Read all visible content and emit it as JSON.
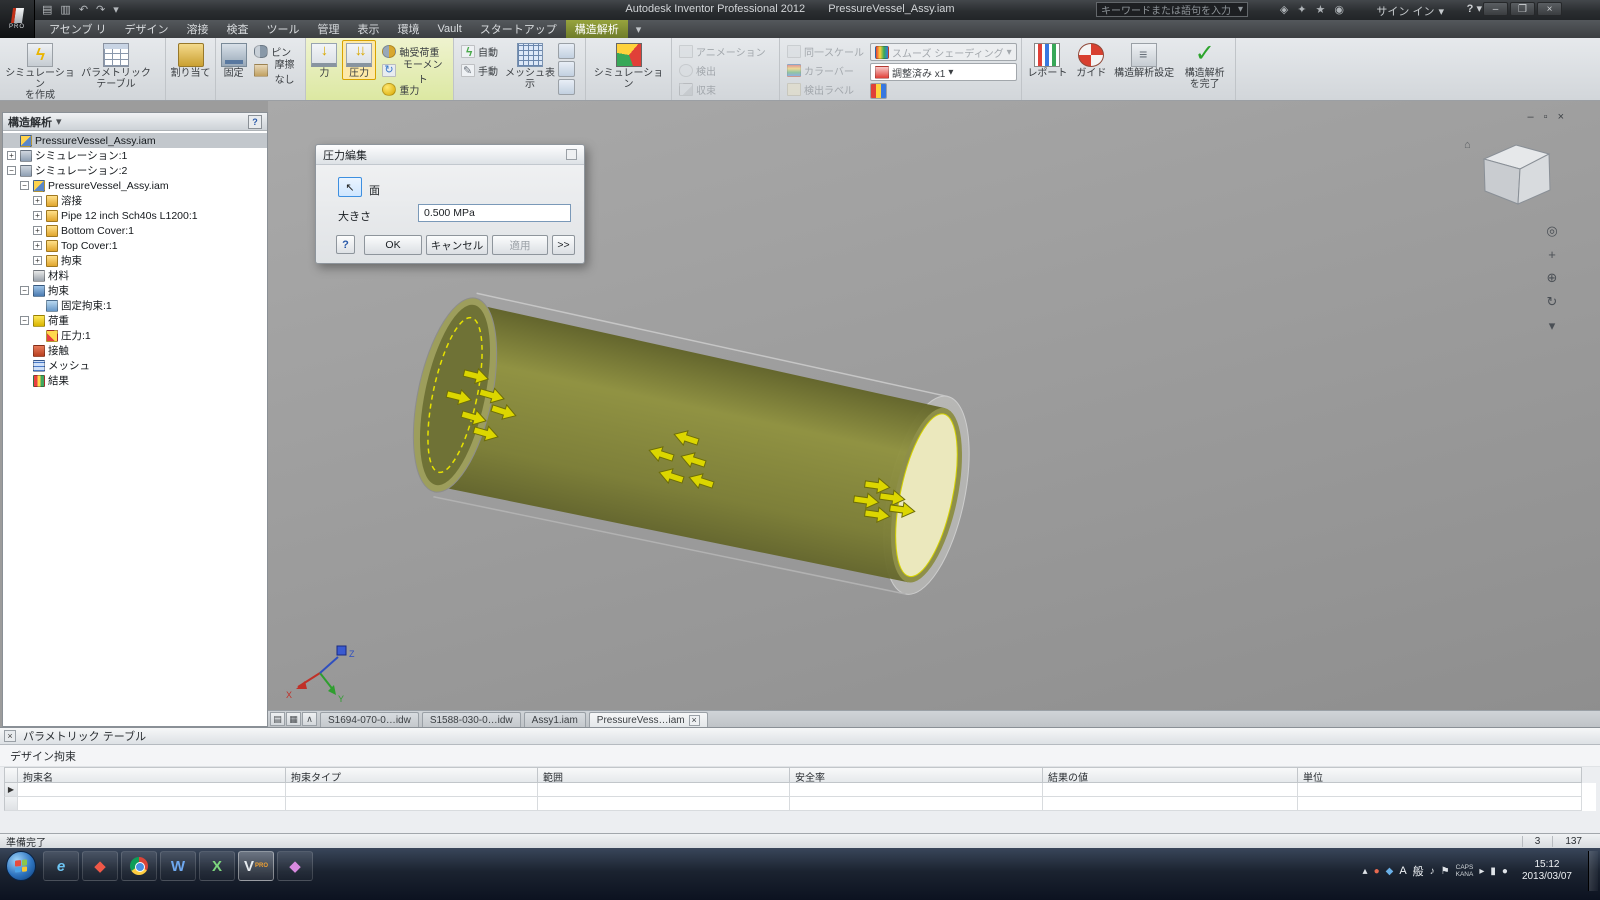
{
  "window": {
    "logo": "PRO",
    "app_title": "Autodesk Inventor Professional 2012",
    "doc_title": "PressureVessel_Assy.iam",
    "search_placeholder": "キーワードまたは語句を入力",
    "signin_label": "サイン イン",
    "help_label": "?"
  },
  "ribbon": {
    "tabs": [
      "アセンブ リ",
      "デザイン",
      "溶接",
      "検査",
      "ツール",
      "管理",
      "表示",
      "環境",
      "Vault",
      "スタートアップ",
      "構造解析"
    ],
    "active_tab": "構造解析",
    "b": {
      "sim_create": "シミュレーション\nを作成",
      "param_table": "パラメトリック\nテーブル",
      "assign": "割り当て",
      "fixed": "固定",
      "pin": "ピン",
      "frictionless": "摩擦なし",
      "force": "力",
      "pressure": "圧力",
      "bearing": "軸受荷重",
      "moment": "モーメント",
      "gravity": "重力",
      "auto": "自動",
      "manual": "手動",
      "mesh_view": "メッシュ表示",
      "simulate": "シミュレーション",
      "animation": "アニメーション",
      "probe": "検出",
      "converge": "収束",
      "same_scale": "同一スケール",
      "color_bar": "カラーバー",
      "probe_label": "検出ラベル",
      "smooth_shading": "スムーズ シェーディング",
      "adjusted": "調整済み x1",
      "report": "レポート",
      "guide": "ガイド",
      "settings": "構造解析設定",
      "finish": "構造解析\nを完了"
    }
  },
  "browser": {
    "title": "構造解析",
    "help": "?",
    "tree": [
      {
        "t": "PressureVessel_Assy.iam",
        "l": 0,
        "e": "",
        "i": "asm",
        "sel": true
      },
      {
        "t": "シミュレーション:1",
        "l": 0,
        "e": "+",
        "i": "sim"
      },
      {
        "t": "シミュレーション:2",
        "l": 0,
        "e": "-",
        "i": "sim"
      },
      {
        "t": "PressureVessel_Assy.iam",
        "l": 1,
        "e": "-",
        "i": "asm"
      },
      {
        "t": "溶接",
        "l": 2,
        "e": "+",
        "i": "folder"
      },
      {
        "t": "Pipe 12 inch Sch40s L1200:1",
        "l": 2,
        "e": "+",
        "i": "folder"
      },
      {
        "t": "Bottom Cover:1",
        "l": 2,
        "e": "+",
        "i": "folder"
      },
      {
        "t": "Top Cover:1",
        "l": 2,
        "e": "+",
        "i": "folder"
      },
      {
        "t": "拘束",
        "l": 2,
        "e": "+",
        "i": "folder2"
      },
      {
        "t": "材料",
        "l": 1,
        "e": "",
        "i": "material"
      },
      {
        "t": "拘束",
        "l": 1,
        "e": "-",
        "i": "constraint"
      },
      {
        "t": "固定拘束:1",
        "l": 2,
        "e": "",
        "i": "fixedc"
      },
      {
        "t": "荷重",
        "l": 1,
        "e": "-",
        "i": "load"
      },
      {
        "t": "圧力:1",
        "l": 2,
        "e": "",
        "i": "pressure"
      },
      {
        "t": "接触",
        "l": 1,
        "e": "",
        "i": "contact"
      },
      {
        "t": "メッシュ",
        "l": 1,
        "e": "",
        "i": "mesh"
      },
      {
        "t": "結果",
        "l": 1,
        "e": "",
        "i": "result"
      }
    ]
  },
  "dialog": {
    "title": "圧力編集",
    "face_label": "面",
    "magnitude_label": "大きさ",
    "magnitude_value": "0.500 MPa",
    "help_label": "?",
    "ok_label": "OK",
    "cancel_label": "キャンセル",
    "apply_label": "適用",
    "more_label": ">>"
  },
  "viewport": {
    "triad": {
      "x": "X",
      "y": "Y",
      "z": "Z"
    }
  },
  "doc_tabs": [
    {
      "label": "S1694-070-0…idw",
      "active": false
    },
    {
      "label": "S1588-030-0…idw",
      "active": false
    },
    {
      "label": "Assy1.iam",
      "active": false
    },
    {
      "label": "PressureVess…iam",
      "active": true
    }
  ],
  "parametric": {
    "title": "パラメトリック テーブル",
    "section": "デザイン拘束",
    "columns": [
      "拘束名",
      "拘束タイプ",
      "範囲",
      "安全率",
      "結果の値",
      "単位"
    ]
  },
  "status": {
    "ready": "準備完了",
    "n1": "3",
    "n2": "137"
  },
  "taskbar": {
    "ime_a": "A",
    "ime_mode": "般",
    "caps": "CAPS",
    "kana": "KANA",
    "time": "15:12",
    "date": "2013/03/07"
  }
}
